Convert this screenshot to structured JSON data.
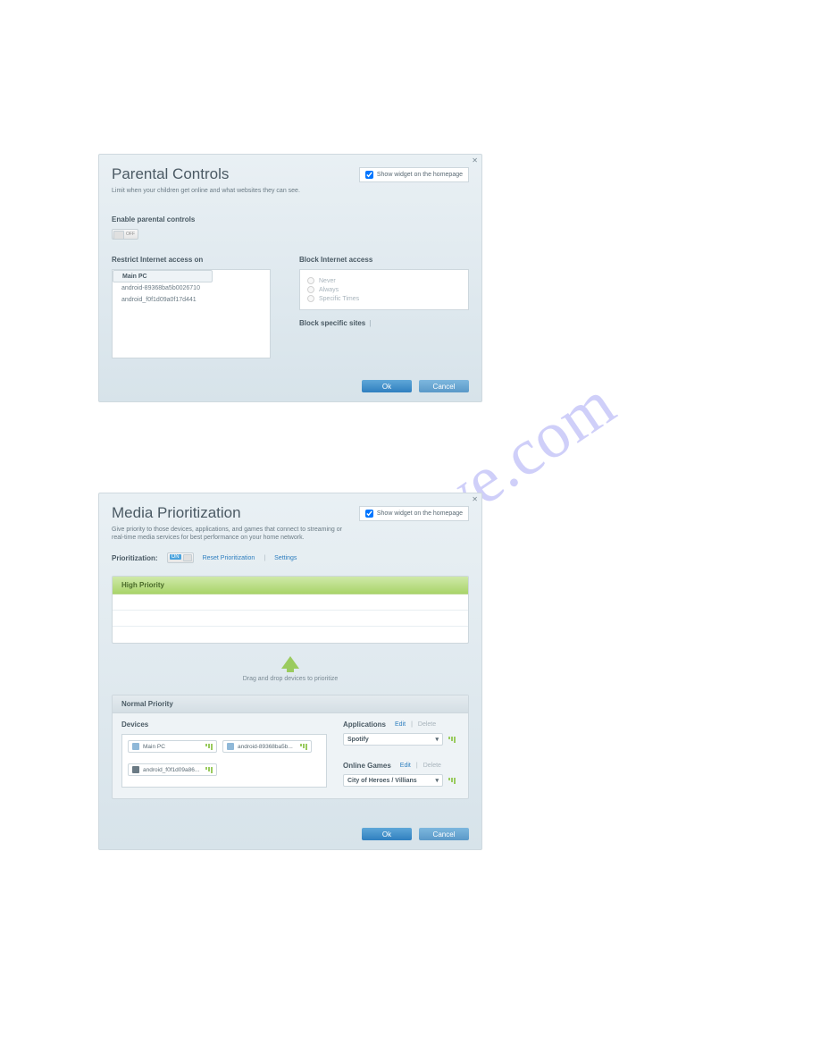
{
  "watermark": "manualshive.com",
  "common": {
    "show_widget_label": "Show widget on the homepage",
    "ok": "Ok",
    "cancel": "Cancel"
  },
  "parental": {
    "title": "Parental Controls",
    "subtitle": "Limit when your children get online and what websites they can see.",
    "enable_label": "Enable parental controls",
    "toggle_state": "OFF",
    "restrict_label": "Restrict Internet access on",
    "devices": [
      "Main PC",
      "android-89368ba5b0026710",
      "android_f0f1d09a0f17d441"
    ],
    "block_label": "Block Internet access",
    "block_options": [
      "Never",
      "Always",
      "Specific Times"
    ],
    "block_sites_label": "Block specific sites"
  },
  "media": {
    "title": "Media Prioritization",
    "subtitle": "Give priority to those devices, applications, and games that connect to streaming or real-time media services for best performance on your home network.",
    "prioritization_label": "Prioritization:",
    "toggle_state": "ON",
    "reset_link": "Reset Prioritization",
    "settings_link": "Settings",
    "high_priority_label": "High Priority",
    "drag_hint": "Drag and drop devices to prioritize",
    "normal_priority_label": "Normal Priority",
    "devices_label": "Devices",
    "device_chips": [
      "Main PC",
      "android-89368ba5b...",
      "android_f0f1d09a86..."
    ],
    "applications_label": "Applications",
    "edit": "Edit",
    "delete": "Delete",
    "app_selected": "Spotify",
    "online_games_label": "Online Games",
    "game_selected": "City of Heroes / Villians"
  }
}
